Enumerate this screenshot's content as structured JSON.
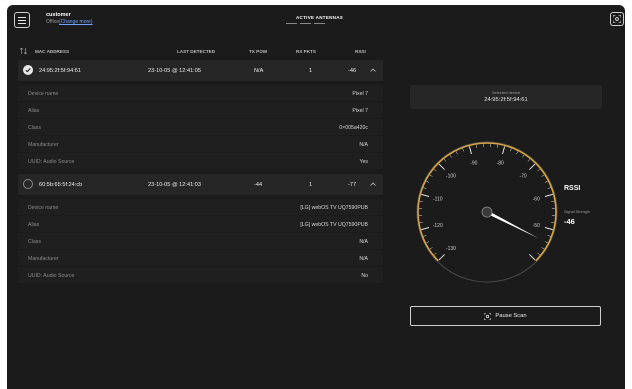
{
  "header": {
    "customer_name": "customer",
    "office_prefix": "Office",
    "change_link": "(Change more)",
    "antennas_label": "ACTIVE ANTENNAS"
  },
  "table": {
    "columns": [
      "MAC ADDRESS",
      "LAST DETECTED",
      "TX POW",
      "RX PKTS",
      "RSSI"
    ],
    "devices": [
      {
        "selected": true,
        "mac": "24:95:2f:5f:94:61",
        "last_detected": "23-10-05 @ 12:41:05",
        "tx_pow": "N/A",
        "rx_pkts": "1",
        "rssi": "-46",
        "details": [
          {
            "key": "Device name",
            "value": "Pixel 7"
          },
          {
            "key": "Alias",
            "value": "Pixel 7"
          },
          {
            "key": "Class",
            "value": "0×005a420c"
          },
          {
            "key": "Manufacturer",
            "value": "N/A"
          },
          {
            "key": "UUID: Audio Source",
            "value": "Yes"
          }
        ]
      },
      {
        "selected": false,
        "mac": "60:5b:65:5f:24:cb",
        "last_detected": "23-10-05 @ 12:41:03",
        "tx_pow": "-44",
        "rx_pkts": "1",
        "rssi": "-77",
        "details": [
          {
            "key": "Device name",
            "value": "[LG] webOS TV UQ7590PUB"
          },
          {
            "key": "Alias",
            "value": "[LG] webOS TV UQ7590PUB"
          },
          {
            "key": "Class",
            "value": "N/A"
          },
          {
            "key": "Manufacturer",
            "value": "N/A"
          },
          {
            "key": "UUID: Audio Source",
            "value": "No"
          }
        ]
      }
    ]
  },
  "selected_panel": {
    "label": "Selected device",
    "mac": "24:95:2f:5f:94:61"
  },
  "gauge": {
    "title": "RSSI",
    "signal_label": "Signal Strength",
    "value_text": "-46",
    "value": -46,
    "min": -130,
    "max": -40,
    "tick_labels": [
      -130,
      -120,
      -110,
      -100,
      -90,
      -80,
      -70,
      -60,
      -50,
      -40
    ],
    "accent_color": "#d9a441"
  },
  "actions": {
    "pause_label": "Pause Scan"
  }
}
